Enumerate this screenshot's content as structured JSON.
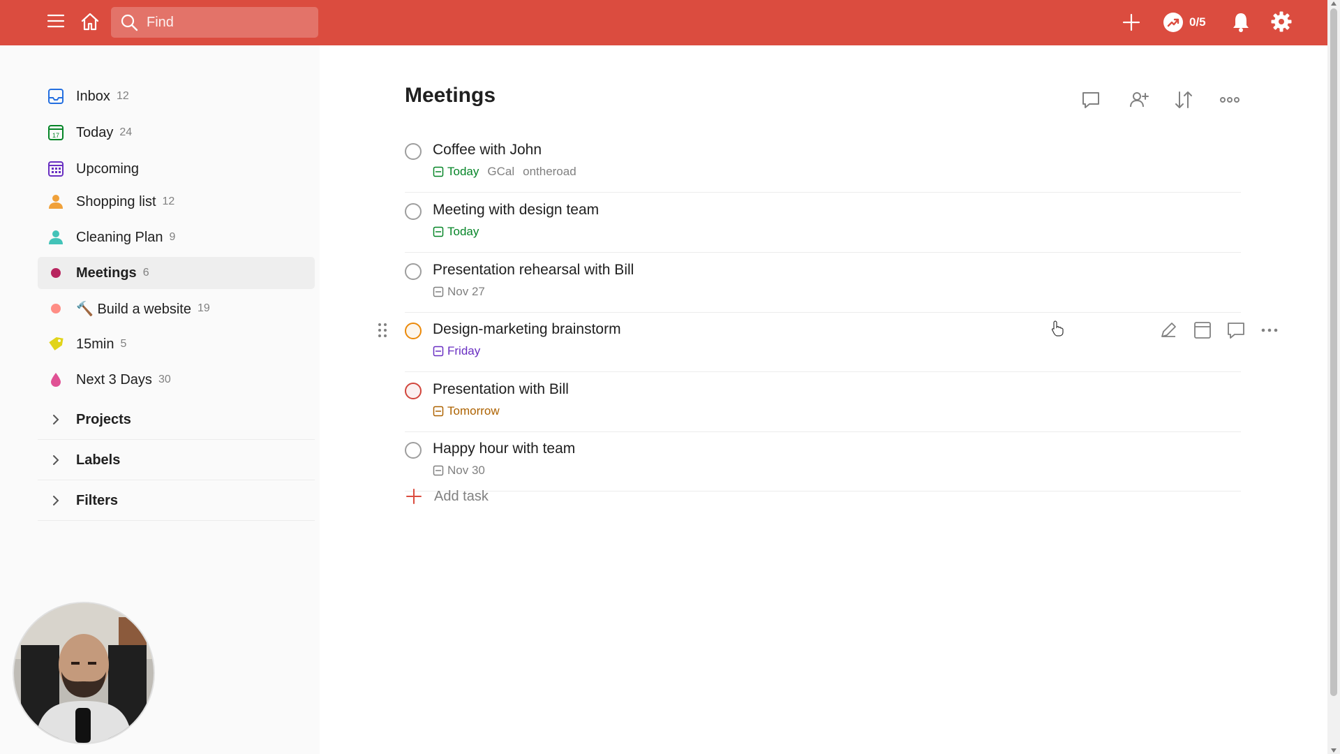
{
  "topbar": {
    "search_placeholder": "Find",
    "karma": "0/5",
    "bg_color": "#db4c3f"
  },
  "sidebar": {
    "items": [
      {
        "label": "Inbox",
        "count": "12",
        "icon": "inbox-icon",
        "color": "#246fe0"
      },
      {
        "label": "Today",
        "count": "24",
        "icon": "calendar-today-icon",
        "color": "#058527"
      },
      {
        "label": "Upcoming",
        "count": "",
        "icon": "calendar-upcoming-icon",
        "color": "#692fc2"
      },
      {
        "label": "Shopping list",
        "count": "12",
        "icon": "person-icon",
        "color": "#f0a13a"
      },
      {
        "label": "Cleaning Plan",
        "count": "9",
        "icon": "person-icon",
        "color": "#42c3b8"
      },
      {
        "label": "Meetings",
        "count": "6",
        "icon": "dot-icon",
        "color": "#b8255f"
      },
      {
        "label": "🔨 Build a website",
        "count": "19",
        "icon": "dot-icon",
        "color": "#ff8d85"
      },
      {
        "label": "15min",
        "count": "5",
        "icon": "tag-icon",
        "color": "#e1d41a"
      },
      {
        "label": "Next 3 Days",
        "count": "30",
        "icon": "drop-icon",
        "color": "#e05194"
      }
    ],
    "sections": [
      {
        "label": "Projects"
      },
      {
        "label": "Labels"
      },
      {
        "label": "Filters"
      }
    ]
  },
  "main": {
    "title": "Meetings",
    "tasks": [
      {
        "title": "Coffee with John",
        "due": "Today",
        "due_color": "#058527",
        "tags": [
          "GCal",
          "ontheroad"
        ],
        "priority": "p4"
      },
      {
        "title": "Meeting with design team",
        "due": "Today",
        "due_color": "#058527",
        "tags": [],
        "priority": "p4"
      },
      {
        "title": "Presentation rehearsal with Bill",
        "due": "Nov 27",
        "due_color": "#808080",
        "tags": [],
        "priority": "p4"
      },
      {
        "title": "Design-marketing brainstorm",
        "due": "Friday",
        "due_color": "#692fc2",
        "tags": [],
        "priority": "p2"
      },
      {
        "title": "Presentation with Bill",
        "due": "Tomorrow",
        "due_color": "#ad6200",
        "tags": [],
        "priority": "p1"
      },
      {
        "title": "Happy hour with team",
        "due": "Nov 30",
        "due_color": "#808080",
        "tags": [],
        "priority": "p4"
      }
    ],
    "add_task_label": "Add task"
  }
}
